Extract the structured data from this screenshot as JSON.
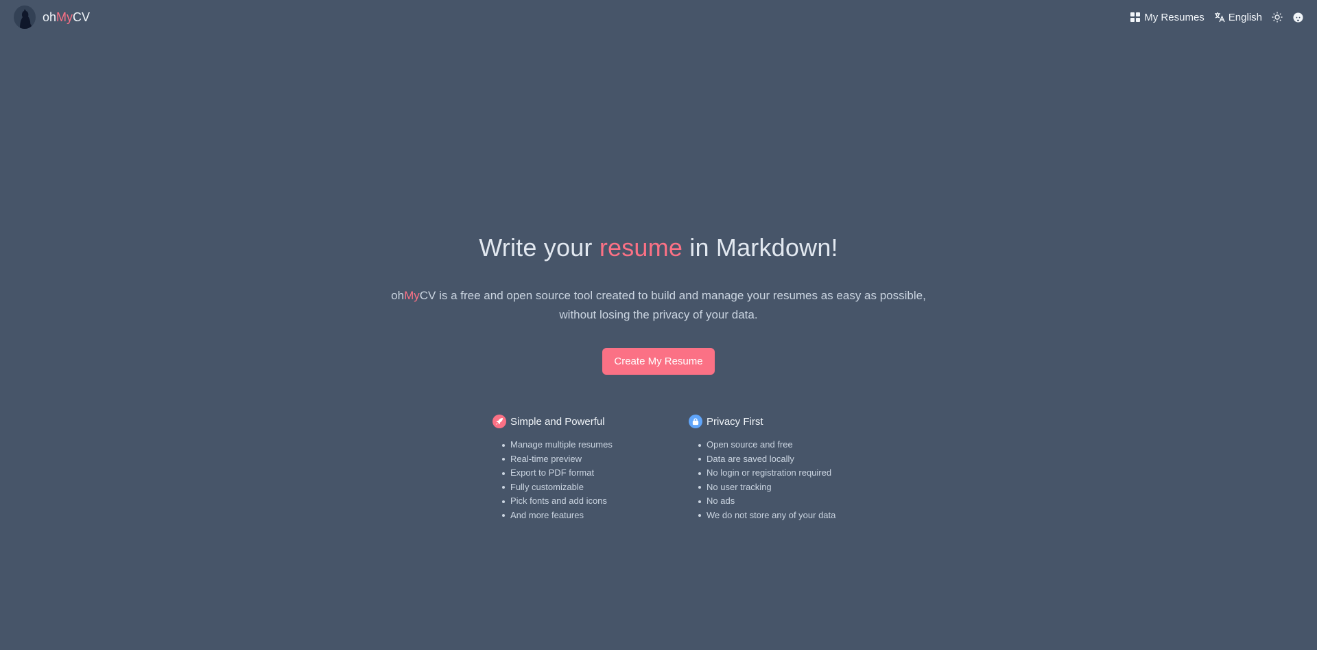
{
  "header": {
    "brand": {
      "prefix": "oh",
      "accent": "My",
      "suffix": "CV"
    },
    "nav": {
      "my_resumes": "My Resumes",
      "language": "English"
    }
  },
  "hero": {
    "headline_before": "Write your ",
    "headline_accent": "resume",
    "headline_after": " in Markdown!",
    "sub_brand_prefix": "oh",
    "sub_brand_accent": "My",
    "sub_brand_suffix": "CV",
    "sub_line1": " is a free and open source tool created to build and manage your resumes as easy as possible,",
    "sub_line2": "without losing the privacy of your data.",
    "cta_label": "Create My Resume"
  },
  "features": [
    {
      "title": "Simple and Powerful",
      "icon": "rocket-icon",
      "items": [
        "Manage multiple resumes",
        "Real-time preview",
        "Export to PDF format",
        "Fully customizable",
        "Pick fonts and add icons",
        "And more features"
      ]
    },
    {
      "title": "Privacy First",
      "icon": "lock-icon",
      "items": [
        "Open source and free",
        "Data are saved locally",
        "No login or registration required",
        "No user tracking",
        "No ads",
        "We do not store any of your data"
      ]
    }
  ],
  "colors": {
    "background": "#475569",
    "accent": "#fb7185",
    "privacy_badge": "#60a5fa"
  }
}
